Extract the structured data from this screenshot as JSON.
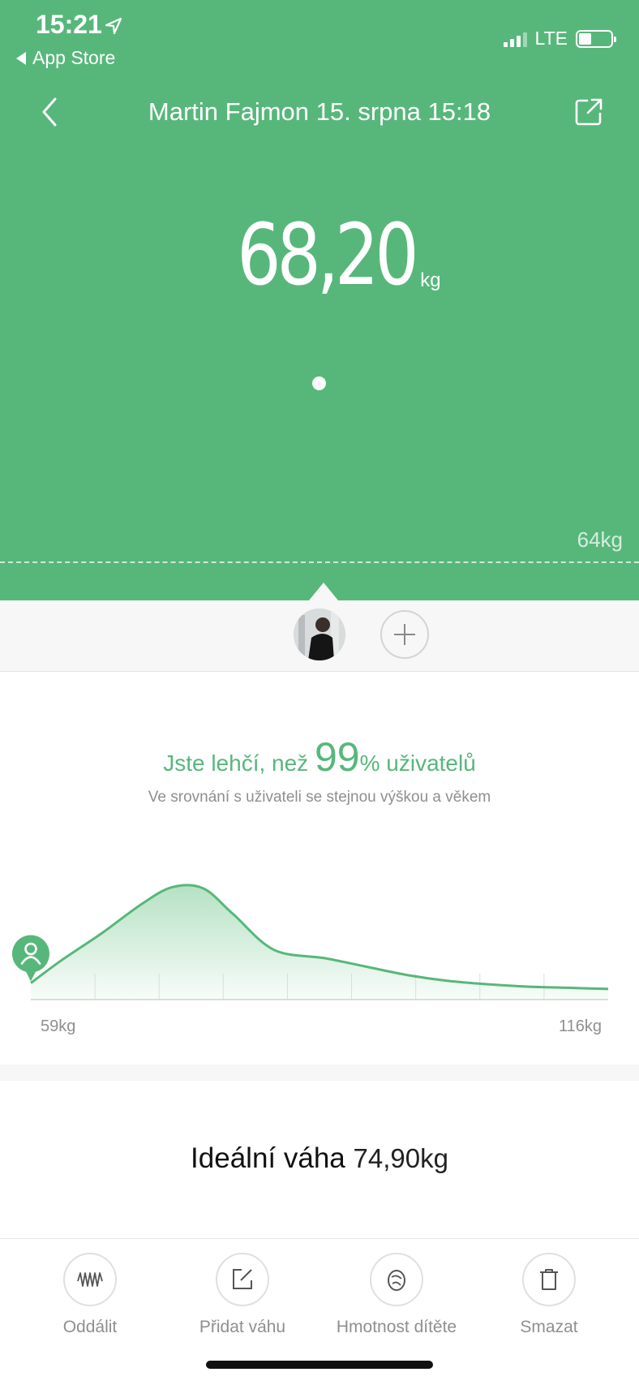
{
  "status_bar": {
    "time": "15:21",
    "back_app": "App Store",
    "network": "LTE",
    "icons": [
      "location-arrow-icon",
      "signal-bars-icon",
      "battery-icon"
    ]
  },
  "nav": {
    "title": "Martin Fajmon 15. srpna 15:18",
    "back_icon": "chevron-left-icon",
    "share_icon": "share-icon"
  },
  "measurement": {
    "value": "68,20",
    "unit": "kg",
    "target_label": "64kg"
  },
  "users": {
    "add_icon": "plus-icon"
  },
  "comparison": {
    "prefix": "Jste lehčí, než ",
    "percent": "99",
    "suffix": "% uživatelů",
    "subtitle": "Ve srovnání s uživateli se stejnou výškou a věkem"
  },
  "chart_data": {
    "type": "area",
    "x_min_label": "59kg",
    "x_max_label": "116kg",
    "xlim": [
      59,
      116
    ],
    "x": [
      59,
      62,
      66,
      70,
      73,
      76,
      79,
      83,
      88,
      92,
      96,
      100,
      104,
      108,
      112,
      116
    ],
    "values": [
      0.14,
      0.33,
      0.56,
      0.81,
      0.95,
      0.94,
      0.72,
      0.42,
      0.35,
      0.28,
      0.21,
      0.16,
      0.13,
      0.11,
      0.1,
      0.09
    ],
    "marker_x": 59,
    "colors": {
      "line": "#57b77b",
      "fill": "#a8dcb9"
    }
  },
  "ideal": {
    "label": "Ideální váha",
    "value": "74,90",
    "unit": "kg"
  },
  "actions": [
    {
      "label": "Oddálit",
      "icon": "waveform-icon"
    },
    {
      "label": "Přidat váhu",
      "icon": "edit-icon"
    },
    {
      "label": "Hmotnost dítěte",
      "icon": "baby-icon"
    },
    {
      "label": "Smazat",
      "icon": "trash-icon"
    }
  ],
  "colors": {
    "brand_green": "#57b77b",
    "background": "#ffffff",
    "muted_text": "#8f8f8f"
  }
}
